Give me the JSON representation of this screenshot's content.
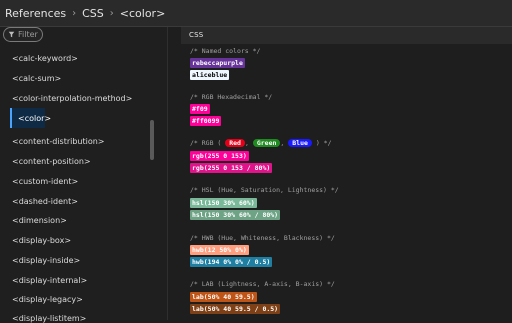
{
  "breadcrumb": {
    "items": [
      "References",
      "CSS",
      "<color>"
    ]
  },
  "sidebar": {
    "filter_placeholder": "Filter",
    "items": [
      {
        "label": "<calc-keyword>"
      },
      {
        "label": "<calc-sum>"
      },
      {
        "label": "<color-interpolation-method>"
      },
      {
        "label": "<color>",
        "selected": true
      },
      {
        "label": "<content-distribution>"
      },
      {
        "label": "<content-position>"
      },
      {
        "label": "<custom-ident>"
      },
      {
        "label": "<dashed-ident>"
      },
      {
        "label": "<dimension>"
      },
      {
        "label": "<display-box>"
      },
      {
        "label": "<display-inside>"
      },
      {
        "label": "<display-internal>"
      },
      {
        "label": "<display-legacy>"
      },
      {
        "label": "<display-listitem>"
      }
    ]
  },
  "main": {
    "header": "CSS",
    "comments": {
      "named": "/* Named colors */",
      "rgb_hex": "/* RGB Hexadecimal */",
      "rgb_prefix": "/* RGB (",
      "rgb_sep": ",",
      "rgb_suffix": ") */",
      "hsl": "/* HSL (Hue, Saturation, Lightness) */",
      "hwb": "/* HWB (Hue, Whiteness, Blackness) */",
      "lab": "/* LAB (Lightness, A-axis, B-axis) */"
    },
    "rgb_names": [
      {
        "text": "Red",
        "bg": "#e5001a",
        "fg": "#ffffff"
      },
      {
        "text": "Green",
        "bg": "#1f8a1f",
        "fg": "#ffffff"
      },
      {
        "text": "Blue",
        "bg": "#1a1aff",
        "fg": "#ffffff"
      }
    ],
    "swatches": [
      {
        "text": "rebeccapurple",
        "bg": "#663399",
        "fg": "#ffffff"
      },
      {
        "text": "aliceblue",
        "bg": "#f0f8ff",
        "fg": "#000000"
      },
      {
        "text": "#f09",
        "bg": "#ff0099",
        "fg": "#ffffff"
      },
      {
        "text": "#ff0099",
        "bg": "#ff0099",
        "fg": "#ffffff"
      },
      {
        "text": "rgb(255 0 153)",
        "bg": "#ff0099",
        "fg": "#ffffff"
      },
      {
        "text": "rgb(255 0 153 / 80%)",
        "bg": "#e0138b",
        "fg": "#ffffff"
      },
      {
        "text": "hsl(150 30% 60%)",
        "bg": "#7ab899",
        "fg": "#ffffff"
      },
      {
        "text": "hsl(150 30% 60% / 80%)",
        "bg": "#6fa386",
        "fg": "#ffffff"
      },
      {
        "text": "hwb(12 50% 0%)",
        "bg": "#ff9f80",
        "fg": "#ffffff"
      },
      {
        "text": "hwb(194 0% 0% / 0.5)",
        "bg": "#1f7fa3",
        "fg": "#ffffff"
      },
      {
        "text": "lab(50% 40 59.5)",
        "bg": "#bf5417",
        "fg": "#ffffff"
      },
      {
        "text": "lab(50% 40 59.5 / 0.5)",
        "bg": "#7e4016",
        "fg": "#ffffff"
      }
    ]
  }
}
